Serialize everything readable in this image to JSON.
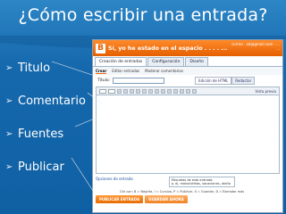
{
  "slide": {
    "title": "¿Cómo escribir una entrada?",
    "bullets": [
      "Titulo",
      "Comentario",
      "Fuentes",
      "Publicar"
    ]
  },
  "screenshot": {
    "blog_name": "Sí, yo he estado en el espacio . . . . ...",
    "account_line1": "correo · ad@gmail.com · ...",
    "account_line2": "...",
    "tabs": [
      "Creación de entradas",
      "Configuración",
      "Diseño"
    ],
    "subtabs": [
      "Crear",
      "Editar entradas",
      "Moderar comentarios"
    ],
    "title_label": "Título:",
    "mode_html": "Edición de HTML",
    "mode_compose": "Redactar",
    "toolbar_font": "fuente",
    "toolbar_size": "tT",
    "toolbar_preview": "Vista previa",
    "options_link": "Opciones de entrada",
    "labels_text": "Etiquetas de esta entrada:",
    "labels_hint": "p. ej. motocicletas, vacaciones, otoño",
    "shortcuts": "Ctrl con: B = Negrita, I = Cursiva, P = Publicar, S = Guardar, D = Borrador más",
    "publish_button": "PUBLICAR ENTRADA",
    "save_button": "GUARDAR AHORA"
  },
  "colors": {
    "background": "#1669ad",
    "header": "#e45f00",
    "text": "#ffffff"
  }
}
